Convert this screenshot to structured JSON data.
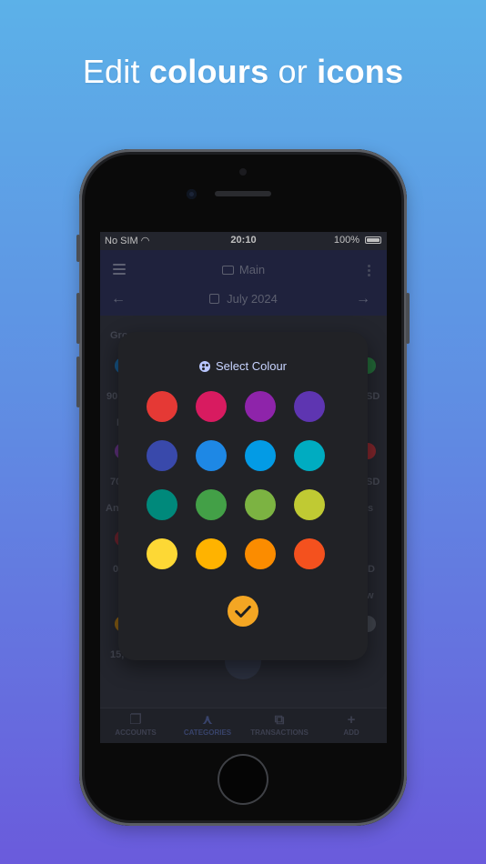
{
  "headline": {
    "part1": "Edit ",
    "bold1": "colours",
    "part2": " or ",
    "bold2": "icons"
  },
  "status_bar": {
    "carrier": "No SIM",
    "time": "20:10",
    "battery": "100%"
  },
  "app_bar": {
    "title": "Main",
    "month": "July 2024",
    "icon": "monitor-icon"
  },
  "background_content": {
    "labels": [
      "Gro",
      "90",
      "L",
      "70",
      "An",
      "0",
      "15,0",
      "SD",
      "SD",
      "s",
      "D",
      "w"
    ]
  },
  "dialog": {
    "title": "Select Colour",
    "title_icon": "palette-icon",
    "swatches": [
      "#e53935",
      "#d81b60",
      "#8e24aa",
      "#5e35b1",
      "#3949ab",
      "#1e88e5",
      "#039be5",
      "#00acc1",
      "#00897b",
      "#43a047",
      "#7cb342",
      "#c0ca33",
      "#fdd835",
      "#ffb300",
      "#fb8c00",
      "#f4511e"
    ],
    "confirm_icon": "check-icon",
    "confirm_color": "#f4a623"
  },
  "tabs": [
    {
      "label": "ACCOUNTS",
      "icon": "accounts-icon"
    },
    {
      "label": "CATEGORIES",
      "icon": "categories-icon"
    },
    {
      "label": "TRANSACTIONS",
      "icon": "transactions-icon"
    },
    {
      "label": "ADD",
      "icon": "plus-icon"
    }
  ]
}
